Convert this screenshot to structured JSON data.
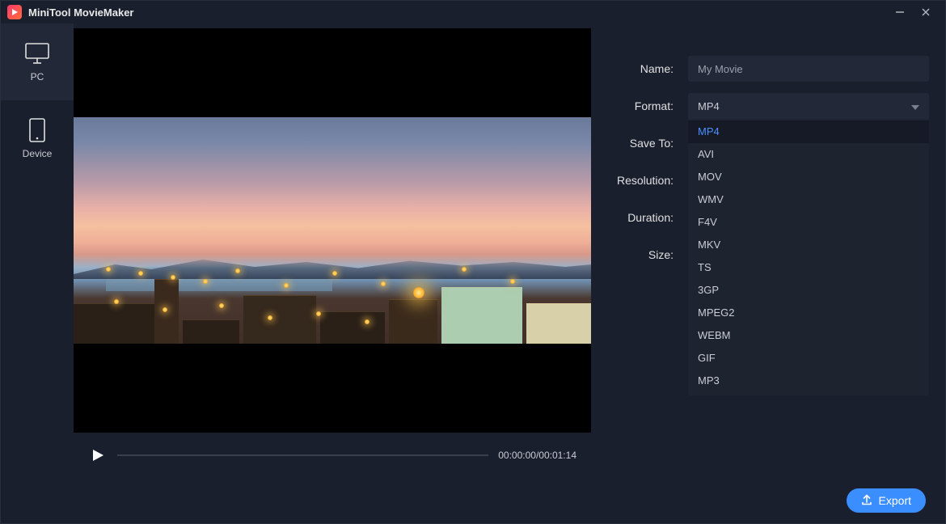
{
  "titlebar": {
    "title": "MiniTool MovieMaker"
  },
  "sidebar": {
    "items": [
      {
        "label": "PC"
      },
      {
        "label": "Device"
      }
    ]
  },
  "player": {
    "current_time": "00:00:00",
    "total_time": "00:01:14"
  },
  "form": {
    "name_label": "Name:",
    "name_value": "My Movie",
    "format_label": "Format:",
    "format_value": "MP4",
    "save_to_label": "Save To:",
    "resolution_label": "Resolution:",
    "duration_label": "Duration:",
    "size_label": "Size:",
    "format_options": [
      "MP4",
      "AVI",
      "MOV",
      "WMV",
      "F4V",
      "MKV",
      "TS",
      "3GP",
      "MPEG2",
      "WEBM",
      "GIF",
      "MP3"
    ]
  },
  "actions": {
    "export_label": "Export"
  }
}
